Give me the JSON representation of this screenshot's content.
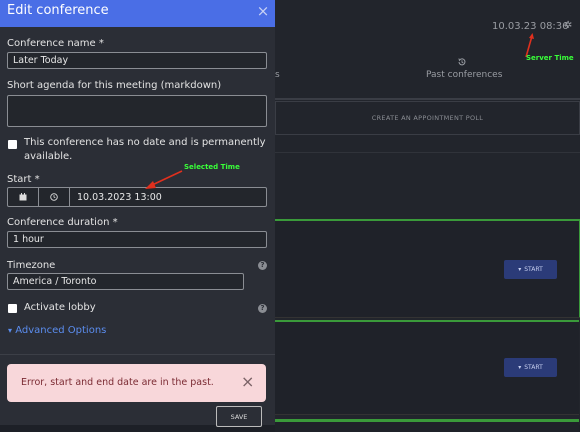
{
  "background": {
    "server_time": "10.03.23 08:36",
    "past_tab_label": "Past conferences",
    "left_tab_fragment": "s",
    "poll_button_label": "CREATE AN APPOINTMENT POLL",
    "start_button_label": "START",
    "accent_green": "#3a9a3a",
    "start_color": "#2b3b78"
  },
  "annotations": {
    "server_time": "Server Time",
    "selected_time": "Selected Time",
    "color": "#39ff39",
    "arrow_color": "#e0301e"
  },
  "panel": {
    "title": "Edit conference",
    "header_color": "#4a6ee6",
    "name_label": "Conference name *",
    "name_value": "Later Today",
    "agenda_label": "Short agenda for this meeting (markdown)",
    "agenda_value": "",
    "permanent_label_1": "This conference has no date and is permanently",
    "permanent_label_2": "available.",
    "start_label": "Start *",
    "start_value": "10.03.2023 13:00",
    "duration_label": "Conference duration *",
    "duration_value": "1 hour",
    "timezone_label": "Timezone",
    "timezone_value": "America / Toronto",
    "lobby_label": "Activate lobby",
    "advanced_label": "Advanced Options",
    "error_text": "Error, start and end date are in the past.",
    "save_label": "SAVE"
  }
}
